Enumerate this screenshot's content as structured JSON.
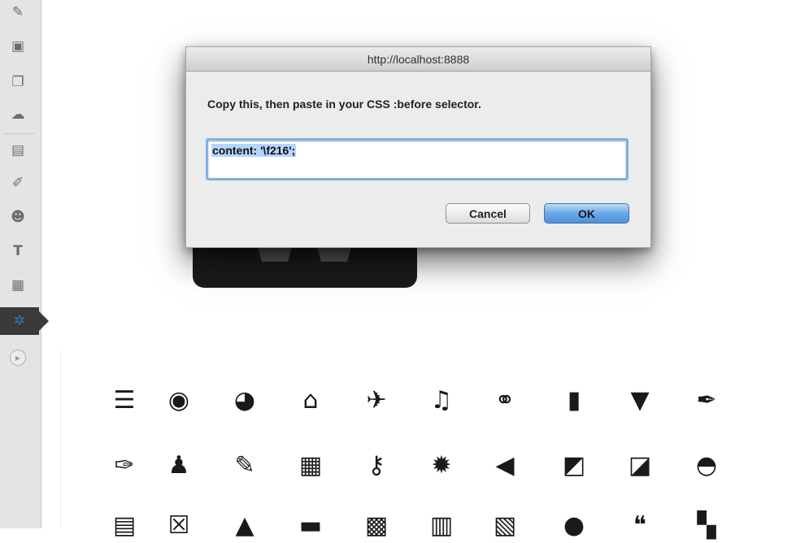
{
  "sidebar": {
    "items": [
      {
        "icon": "pin-icon",
        "glyph": "✎"
      },
      {
        "icon": "media-icon",
        "glyph": "▣"
      },
      {
        "icon": "pages-icon",
        "glyph": "❐"
      },
      {
        "icon": "comments-icon",
        "glyph": "☁"
      },
      {
        "icon": "appearance-icon",
        "glyph": "▤"
      },
      {
        "icon": "plugins-icon",
        "glyph": "✐"
      },
      {
        "icon": "users-icon",
        "glyph": "☻"
      },
      {
        "icon": "tools-icon",
        "glyph": "T"
      },
      {
        "icon": "settings-icon",
        "glyph": "▦"
      },
      {
        "icon": "dashicons-icon",
        "glyph": "✲",
        "active": true
      }
    ],
    "collapse_glyph": "▶"
  },
  "dialog": {
    "title": "http://localhost:8888",
    "message": "Copy this, then paste in your CSS :before selector.",
    "input_value": "content: '\\f216';",
    "cancel_label": "Cancel",
    "ok_label": "OK"
  },
  "icon_grid": [
    [
      {
        "name": "menu-icon",
        "glyph": "☰"
      },
      {
        "name": "globe-icon",
        "glyph": "◉"
      },
      {
        "name": "dashboard-icon",
        "glyph": "◕"
      },
      {
        "name": "home-icon",
        "glyph": "⌂"
      },
      {
        "name": "pin-icon",
        "glyph": "✈"
      },
      {
        "name": "media-music-icon",
        "glyph": "♫"
      },
      {
        "name": "link-icon",
        "glyph": "⚭"
      },
      {
        "name": "pages-icon",
        "glyph": "▮"
      },
      {
        "name": "comment-icon",
        "glyph": "▼"
      },
      {
        "name": "brush-icon",
        "glyph": "✒"
      }
    ],
    [
      {
        "name": "plugin-icon",
        "glyph": "✑"
      },
      {
        "name": "user-icon",
        "glyph": "♟"
      },
      {
        "name": "wrench-icon",
        "glyph": "✎"
      },
      {
        "name": "settings-sliders-icon",
        "glyph": "▦"
      },
      {
        "name": "key-icon",
        "glyph": "⚷"
      },
      {
        "name": "gear-icon",
        "glyph": "✹"
      },
      {
        "name": "back-arrow-icon",
        "glyph": "◀"
      },
      {
        "name": "edit-page-icon",
        "glyph": "◩"
      },
      {
        "name": "new-page-icon",
        "glyph": "◪"
      },
      {
        "name": "visibility-icon",
        "glyph": "◓"
      }
    ],
    [
      {
        "name": "table-icon",
        "glyph": "▤"
      },
      {
        "name": "dismiss-icon",
        "glyph": "☒"
      },
      {
        "name": "education-icon",
        "glyph": "▲"
      },
      {
        "name": "text-page-icon",
        "glyph": "▬"
      },
      {
        "name": "image-icon",
        "glyph": "▩"
      },
      {
        "name": "chart-icon",
        "glyph": "▥"
      },
      {
        "name": "video-icon",
        "glyph": "▧"
      },
      {
        "name": "chat-icon",
        "glyph": "●"
      },
      {
        "name": "quote-icon",
        "glyph": "❝"
      },
      {
        "name": "groups-icon",
        "glyph": "▚"
      }
    ]
  ]
}
